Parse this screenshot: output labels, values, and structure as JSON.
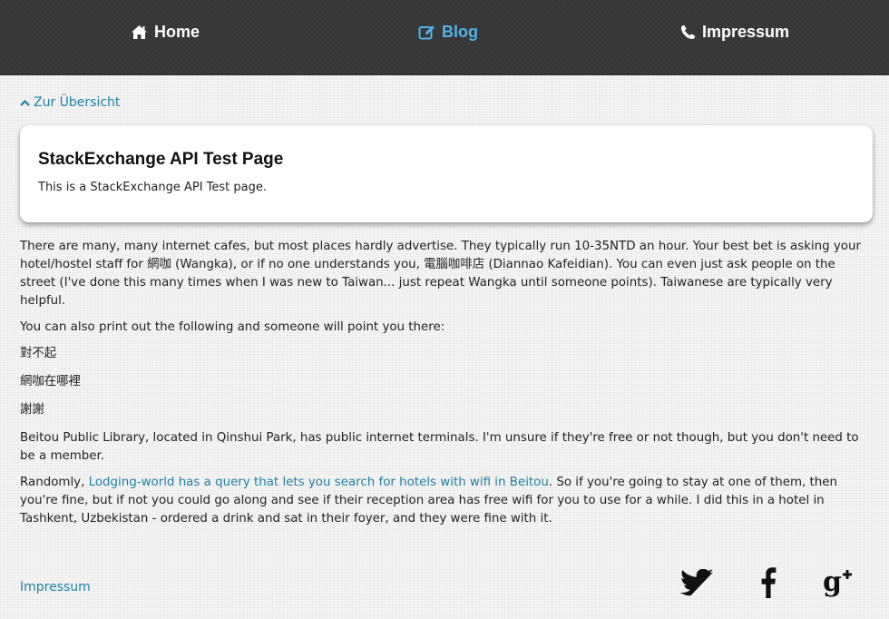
{
  "nav": {
    "items": [
      {
        "label": "Home",
        "icon": "home-icon",
        "active": false
      },
      {
        "label": "Blog",
        "icon": "edit-icon",
        "active": true
      },
      {
        "label": "Impressum",
        "icon": "phone-icon",
        "active": false
      }
    ]
  },
  "back_link": {
    "label": "Zur Übersicht",
    "icon": "chevron-up-icon"
  },
  "card": {
    "title": "StackExchange API Test Page",
    "description": "This is a StackExchange API Test page."
  },
  "article": {
    "p1": "There are many, many internet cafes, but most places hardly advertise. They typically run 10-35NTD an hour. Your best bet is asking your hotel/hostel staff for 網咖 (Wangka), or if no one understands you, 電腦咖啡店 (Diannao Kafeidian). You can even just ask people on the street (I've done this many times when I was new to Taiwan... just repeat Wangka until someone points). Taiwanese are typically very helpful.",
    "p2": "You can also print out the following and someone will point you there:",
    "cjk1": "對不起",
    "cjk2": "網咖在哪裡",
    "cjk3": "謝謝",
    "p3": "Beitou Public Library, located in Qinshui Park, has public internet terminals. I'm unsure if they're free or not though, but you don't need to be a member.",
    "p4_before": "Randomly, ",
    "p4_link": "Lodging-world has a query that lets you search for hotels with wifi in Beitou",
    "p4_after": ". So if you're going to stay at one of them, then you're fine, but if not you could go along and see if their reception area has free wifi for you to use for a while. I did this in a hotel in Tashkent, Uzbekistan - ordered a drink and sat in their foyer, and they were fine with it."
  },
  "footer": {
    "impressum_label": "Impressum",
    "social": [
      {
        "icon": "twitter-icon"
      },
      {
        "icon": "facebook-icon"
      },
      {
        "icon": "google-plus-icon"
      }
    ]
  },
  "colors": {
    "nav_background": "#383838",
    "nav_text": "#ffffff",
    "nav_active": "#4fb3e8",
    "link": "#1f7fa3",
    "page_background": "#f3f3f3",
    "social_icons": "#111111"
  }
}
